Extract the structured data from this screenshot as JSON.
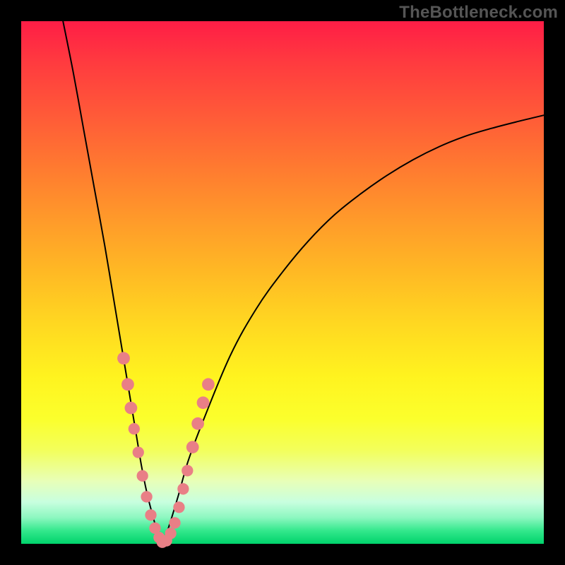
{
  "watermark": "TheBottleneck.com",
  "chart_data": {
    "type": "line",
    "title": "",
    "xlabel": "",
    "ylabel": "",
    "xlim": [
      0,
      100
    ],
    "ylim": [
      0,
      100
    ],
    "axes_visible": false,
    "grid": false,
    "background_gradient": {
      "stops": [
        {
          "pos": 0.0,
          "color": "#ff1d46"
        },
        {
          "pos": 0.5,
          "color": "#ffc823"
        },
        {
          "pos": 0.75,
          "color": "#fff720"
        },
        {
          "pos": 0.95,
          "color": "#8cf7c0"
        },
        {
          "pos": 1.0,
          "color": "#00d36b"
        }
      ]
    },
    "series": [
      {
        "name": "left-branch",
        "color": "#000000",
        "width": 2,
        "x": [
          8,
          10,
          12,
          14,
          16,
          18,
          20,
          21,
          22,
          23,
          24,
          25,
          26,
          27
        ],
        "y": [
          100,
          90,
          79,
          68,
          57,
          45,
          33,
          27,
          21,
          15,
          10,
          6,
          2.5,
          0
        ]
      },
      {
        "name": "right-branch",
        "color": "#000000",
        "width": 2,
        "x": [
          27,
          28,
          30,
          32,
          35,
          40,
          45,
          50,
          55,
          60,
          65,
          70,
          75,
          80,
          85,
          90,
          95,
          100
        ],
        "y": [
          0,
          2.5,
          9,
          16,
          24,
          36,
          45,
          52,
          58,
          63,
          67,
          70.5,
          73.5,
          76,
          78,
          79.5,
          80.8,
          82
        ]
      }
    ],
    "markers": [
      {
        "x": 19.6,
        "y": 35.5,
        "r": 1.2,
        "color": "#e97f86"
      },
      {
        "x": 20.4,
        "y": 30.5,
        "r": 1.2,
        "color": "#e97f86"
      },
      {
        "x": 21.0,
        "y": 26.0,
        "r": 1.2,
        "color": "#e97f86"
      },
      {
        "x": 21.6,
        "y": 22.0,
        "r": 1.1,
        "color": "#e97f86"
      },
      {
        "x": 22.4,
        "y": 17.5,
        "r": 1.1,
        "color": "#e97f86"
      },
      {
        "x": 23.2,
        "y": 13.0,
        "r": 1.1,
        "color": "#e97f86"
      },
      {
        "x": 24.0,
        "y": 9.0,
        "r": 1.1,
        "color": "#e97f86"
      },
      {
        "x": 24.8,
        "y": 5.5,
        "r": 1.1,
        "color": "#e97f86"
      },
      {
        "x": 25.6,
        "y": 3.0,
        "r": 1.1,
        "color": "#e97f86"
      },
      {
        "x": 26.4,
        "y": 1.2,
        "r": 1.1,
        "color": "#e97f86"
      },
      {
        "x": 27.0,
        "y": 0.3,
        "r": 1.1,
        "color": "#e97f86"
      },
      {
        "x": 27.8,
        "y": 0.6,
        "r": 1.1,
        "color": "#e97f86"
      },
      {
        "x": 28.6,
        "y": 2.0,
        "r": 1.1,
        "color": "#e97f86"
      },
      {
        "x": 29.4,
        "y": 4.0,
        "r": 1.1,
        "color": "#e97f86"
      },
      {
        "x": 30.2,
        "y": 7.0,
        "r": 1.1,
        "color": "#e97f86"
      },
      {
        "x": 31.0,
        "y": 10.5,
        "r": 1.1,
        "color": "#e97f86"
      },
      {
        "x": 31.8,
        "y": 14.0,
        "r": 1.1,
        "color": "#e97f86"
      },
      {
        "x": 32.8,
        "y": 18.5,
        "r": 1.2,
        "color": "#e97f86"
      },
      {
        "x": 33.8,
        "y": 23.0,
        "r": 1.2,
        "color": "#e97f86"
      },
      {
        "x": 34.8,
        "y": 27.0,
        "r": 1.2,
        "color": "#e97f86"
      },
      {
        "x": 35.8,
        "y": 30.5,
        "r": 1.2,
        "color": "#e97f86"
      }
    ],
    "notch": {
      "x": 27,
      "y_min": 0
    }
  }
}
